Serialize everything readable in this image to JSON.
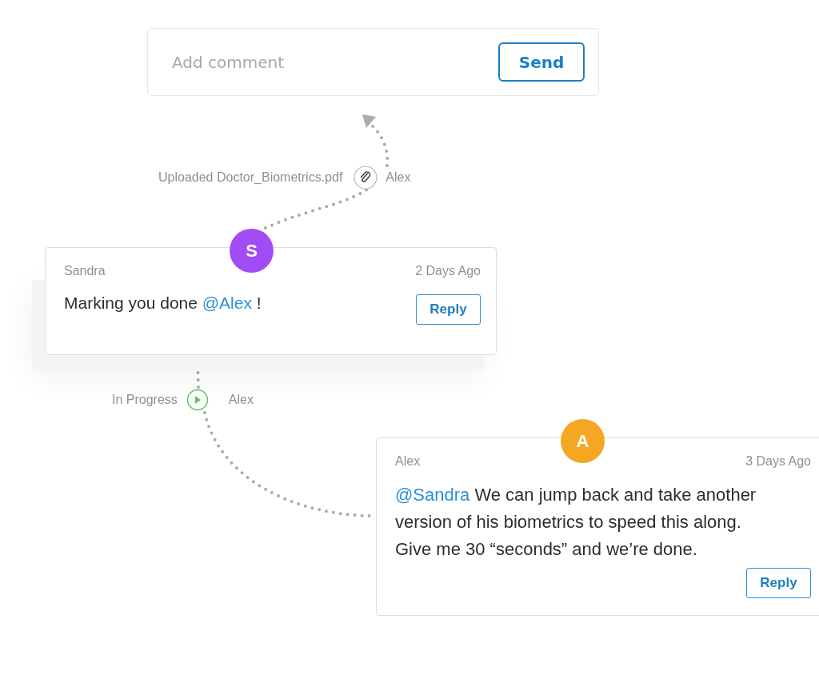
{
  "comment_box": {
    "placeholder": "Add comment",
    "button": "Send"
  },
  "events": [
    {
      "kind": "attachment",
      "text": "Uploaded Doctor_Biometrics.pdf",
      "actor": "Alex"
    },
    {
      "kind": "progress",
      "text": "In Progress",
      "actor": "Alex"
    }
  ],
  "comments": [
    {
      "author": "Sandra",
      "initial": "S",
      "color": "#a24cf6",
      "time": "2 Days Ago",
      "message": [
        {
          "kind": "text",
          "text": "Marking you done "
        },
        {
          "kind": "mention",
          "text": "@Alex"
        },
        {
          "kind": "text",
          "text": " !"
        }
      ],
      "reply": "Reply"
    },
    {
      "author": "Alex",
      "initial": "A",
      "color": "#f5a623",
      "time": "3 Days Ago",
      "message": [
        {
          "kind": "mention",
          "text": "@Sandra"
        },
        {
          "kind": "text",
          "text": " We can jump back and take another version of his biometrics to speed this along. Give me 30 “seconds” and we’re done."
        }
      ],
      "reply": "Reply"
    }
  ]
}
